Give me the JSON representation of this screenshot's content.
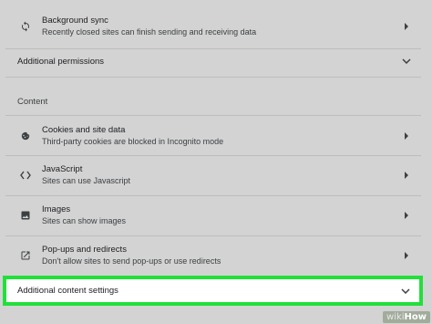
{
  "background_sync": {
    "title": "Background sync",
    "subtitle": "Recently closed sites can finish sending and receiving data",
    "icon": "sync-icon"
  },
  "additional_permissions": {
    "label": "Additional permissions"
  },
  "content_section": {
    "label": "Content"
  },
  "items": [
    {
      "title": "Cookies and site data",
      "subtitle": "Third-party cookies are blocked in Incognito mode",
      "icon": "cookie-icon"
    },
    {
      "title": "JavaScript",
      "subtitle": "Sites can use Javascript",
      "icon": "code-icon"
    },
    {
      "title": "Images",
      "subtitle": "Sites can show images",
      "icon": "image-icon"
    },
    {
      "title": "Pop-ups and redirects",
      "subtitle": "Don't allow sites to send pop-ups or use redirects",
      "icon": "open-in-new-icon"
    }
  ],
  "additional_content": {
    "label": "Additional content settings"
  },
  "watermark": {
    "wiki": "wiki",
    "how": "How"
  },
  "colors": {
    "highlight": "#22e03a",
    "background": "#d3d3d3"
  }
}
